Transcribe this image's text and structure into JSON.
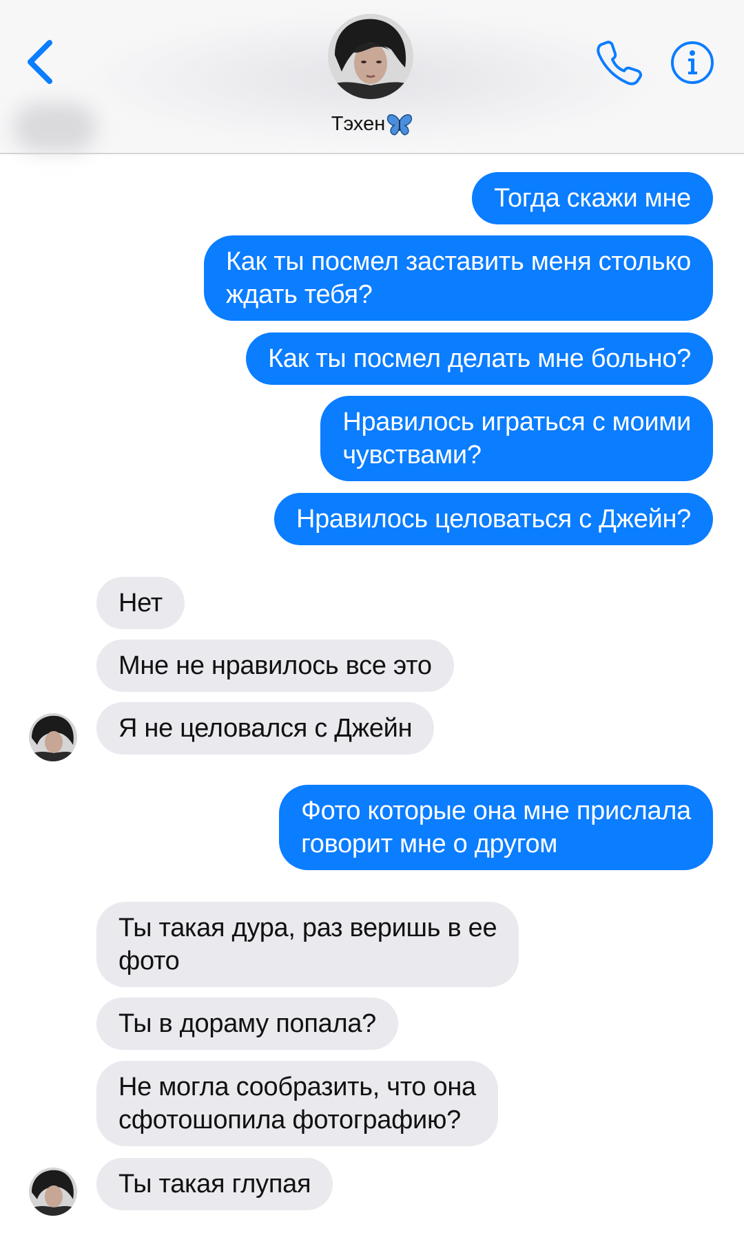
{
  "header": {
    "contact_name": "Тэхен",
    "butterfly_emoji": "🦋"
  },
  "messages": [
    {
      "side": "out",
      "text": "Тогда скажи мне"
    },
    {
      "side": "out",
      "text": "Как ты посмел заставить меня столько",
      "text2": "ждать тебя?"
    },
    {
      "side": "out",
      "text": "Как ты посмел делать мне больно?"
    },
    {
      "side": "out",
      "text": "Нравилось играться с моими",
      "text2": "чувствами?"
    },
    {
      "side": "out",
      "text": "Нравилось целоваться с Джейн?"
    },
    {
      "side": "in",
      "text": "Нет"
    },
    {
      "side": "in",
      "text": "Мне не нравилось все это"
    },
    {
      "side": "in",
      "text": "Я не целовался с Джейн"
    },
    {
      "side": "out",
      "text": "Фото которые она мне прислала",
      "text2": "говорит мне о другом"
    },
    {
      "side": "in",
      "text": "Ты такая дура, раз веришь в ее",
      "text2": "фото"
    },
    {
      "side": "in",
      "text": "Ты в дораму попала?"
    },
    {
      "side": "in",
      "text": "Не могла сообразить, что она",
      "text2": "сфотошопила фотографию?"
    },
    {
      "side": "in",
      "text": "Ты такая глупая"
    }
  ],
  "colors": {
    "accent": "#0b7dff",
    "incoming_bubble": "#e9e9ee",
    "header_bg": "#f7f7f8"
  },
  "icons": {
    "back": "chevron-left-icon",
    "call": "phone-icon",
    "info": "info-icon"
  }
}
